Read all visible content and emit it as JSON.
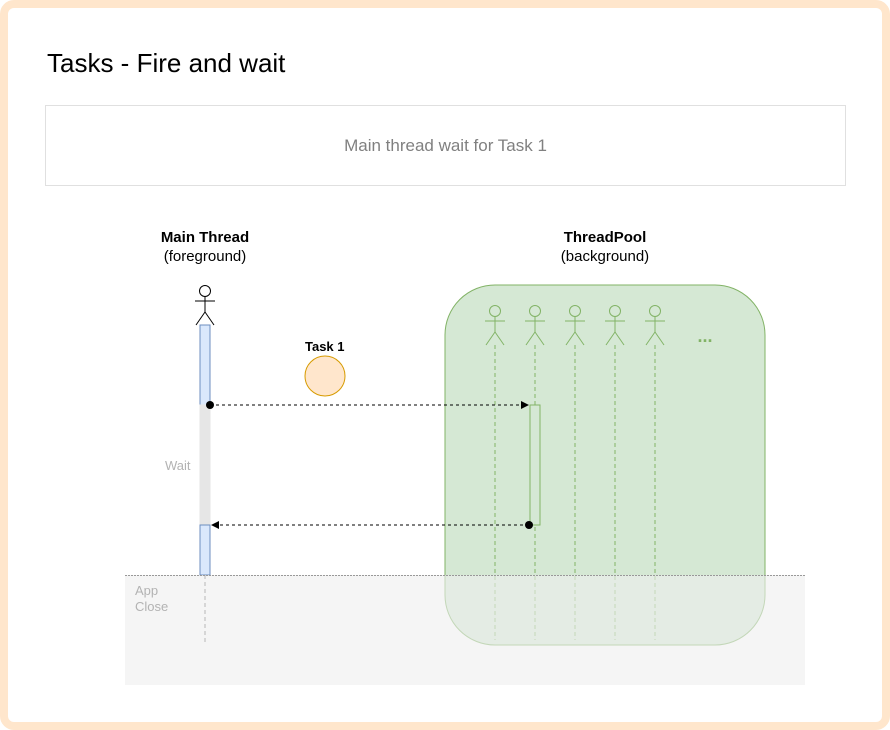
{
  "title": "Tasks - Fire and wait",
  "subtitle": "Main thread wait for Task 1",
  "main_thread": {
    "name": "Main Thread",
    "kind": "(foreground)"
  },
  "thread_pool": {
    "name": "ThreadPool",
    "kind": "(background)",
    "more": "..."
  },
  "task": {
    "label": "Task 1"
  },
  "wait_label": "Wait",
  "app_close_label": {
    "line1": "App",
    "line2": "Close"
  },
  "colors": {
    "frame": "#ffe6cc",
    "thread_pool_fill": "#d5e8d4",
    "thread_pool_stroke": "#82b366",
    "main_lifeline_fill": "#dae8fc",
    "main_lifeline_stroke": "#6c8ebf",
    "wait_fill": "#e6e6e6",
    "task_fill": "#ffe6cc",
    "task_stroke": "#d79b00",
    "app_close_fill": "#eeeeee"
  }
}
